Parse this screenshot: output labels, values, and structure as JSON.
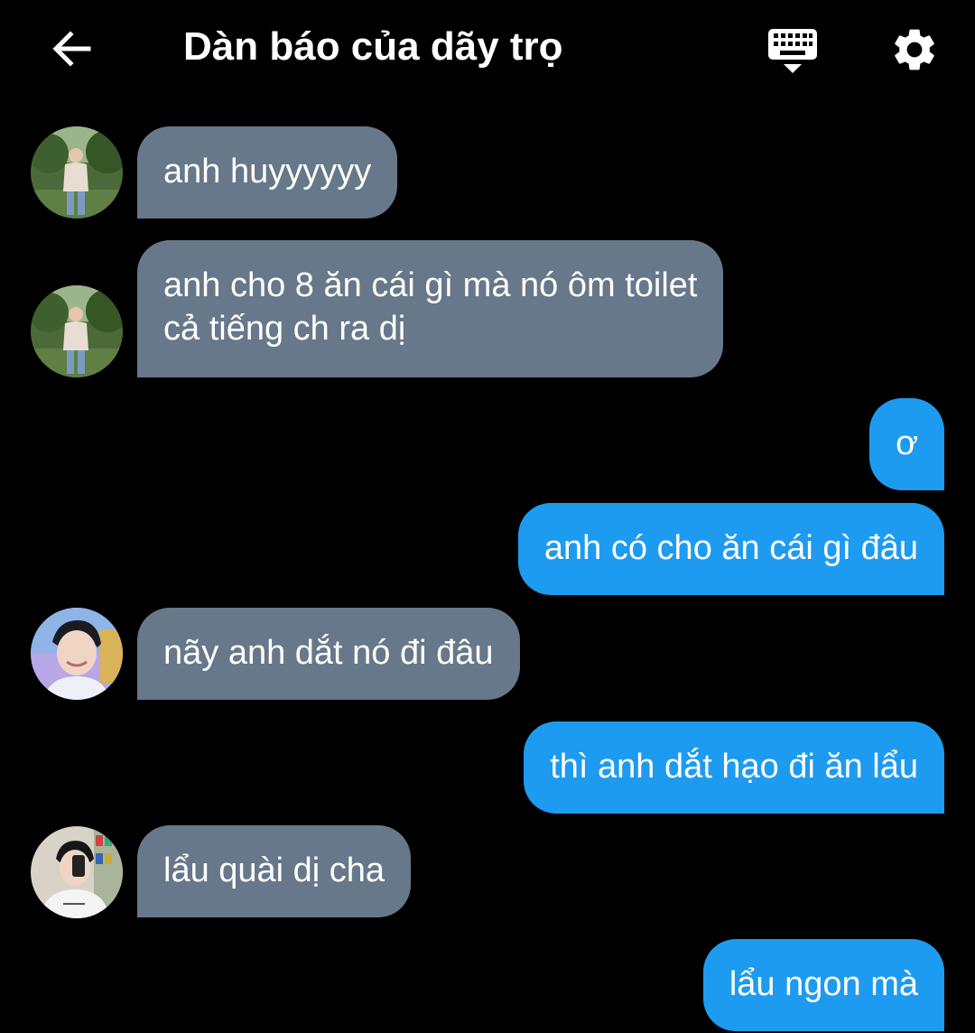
{
  "header": {
    "title": "Dàn báo của dãy trọ",
    "back_icon": "arrow-left-icon",
    "keyboard_icon": "keyboard-icon",
    "settings_icon": "gear-icon"
  },
  "colors": {
    "background": "#000000",
    "incoming_bubble": "#66788a",
    "outgoing_bubble": "#1d9bf0",
    "text": "#ffffff"
  },
  "messages": [
    {
      "direction": "incoming",
      "sender_avatar": "avatar-outdoor-photo",
      "text": "anh huyyyyyy"
    },
    {
      "direction": "incoming",
      "sender_avatar": "avatar-outdoor-photo",
      "text": "anh cho 8 ăn cái gì mà nó ôm toilet\ncả tiếng ch ra dị"
    },
    {
      "direction": "outgoing",
      "text": "ơ"
    },
    {
      "direction": "outgoing",
      "text": "anh có cho ăn cái gì đâu"
    },
    {
      "direction": "incoming",
      "sender_avatar": "avatar-smiling-photo",
      "text": "nãy anh dắt nó đi đâu"
    },
    {
      "direction": "outgoing",
      "text": "thì anh dắt hạo đi ăn lẩu"
    },
    {
      "direction": "incoming",
      "sender_avatar": "avatar-mirror-selfie-photo",
      "text": "lẩu quài dị cha"
    },
    {
      "direction": "outgoing",
      "text": "lẩu ngon mà"
    }
  ]
}
